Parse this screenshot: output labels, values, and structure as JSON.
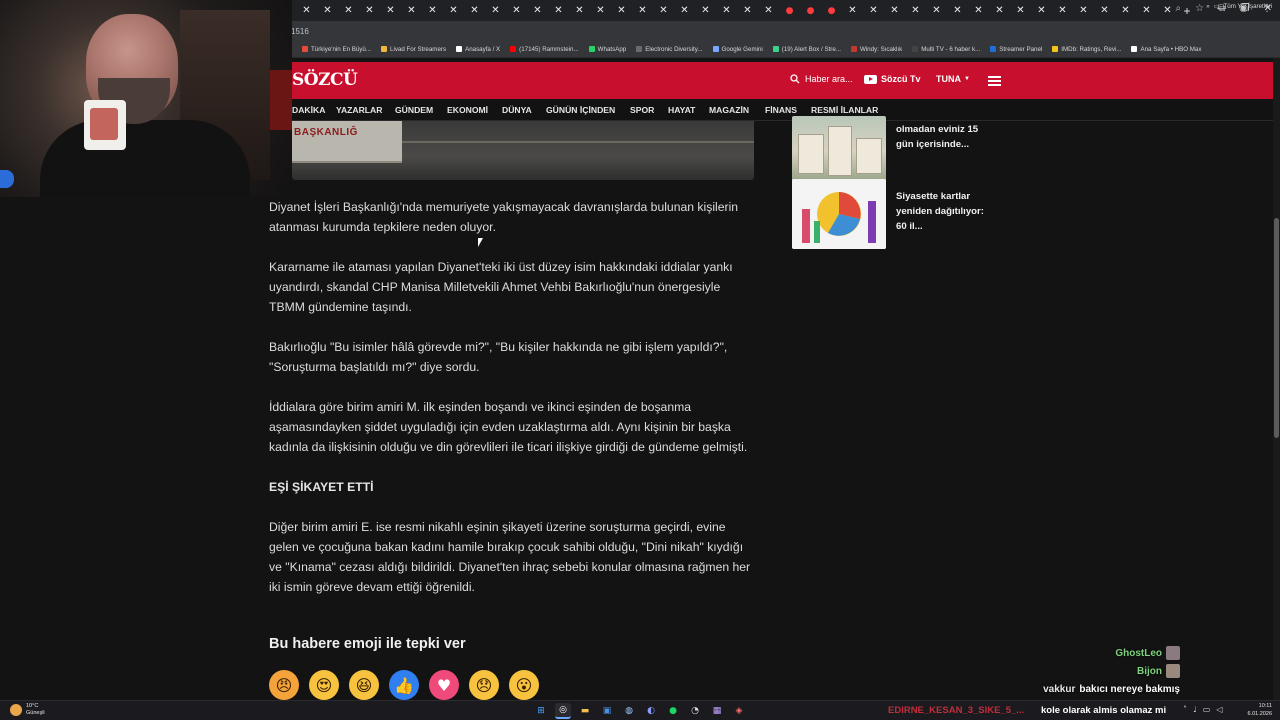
{
  "browser": {
    "tabs_visible": 42,
    "url_fragment": "1516",
    "bookmarks": [
      {
        "label": "Türkiye'nin En Büyü...",
        "color": "#e84a3a"
      },
      {
        "label": "Livad For Streamers",
        "color": "#f0b640"
      },
      {
        "label": "Anasayfa / X",
        "color": "#ffffff"
      },
      {
        "label": "(17145) Rammstein...",
        "color": "#ff0000"
      },
      {
        "label": "WhatsApp",
        "color": "#25d366"
      },
      {
        "label": "Electronic Diversity...",
        "color": "#6a6a6a"
      },
      {
        "label": "Google Gemini",
        "color": "#7aa7ff"
      },
      {
        "label": "(19) Alert Box / Stre...",
        "color": "#3bd38b"
      },
      {
        "label": "Windy: Sıcaklık",
        "color": "#c0392b"
      },
      {
        "label": "Multi TV - 6 haber k...",
        "color": "#444444"
      },
      {
        "label": "Streamer Panel",
        "color": "#1e6fd9"
      },
      {
        "label": "IMDb: Ratings, Revi...",
        "color": "#f5c518"
      },
      {
        "label": "Ana Sayfa • HBO Max",
        "color": "#ffffff"
      }
    ],
    "bookmarks_more": "»",
    "all_bookmarks": "Tüm Yer İşaretleri"
  },
  "site": {
    "logo": "SÖZCÜ",
    "search_placeholder": "Haber ara...",
    "tv_label": "Sözcü Tv",
    "user": "TUNA",
    "nav": [
      "DAKİKA",
      "YAZARLAR",
      "GÜNDEM",
      "EKONOMİ",
      "DÜNYA",
      "GÜNÜN İÇİNDEN",
      "SPOR",
      "HAYAT",
      "MAGAZİN",
      "FİNANS",
      "RESMİ İLANLAR"
    ],
    "accent": "#c8102e"
  },
  "hero": {
    "sign_text": "BAŞKANLIĞ"
  },
  "article": {
    "p1": "Diyanet İşleri Başkanlığı'nda memuriyete yakışmayacak davranışlarda bulunan kişilerin atanması kurumda tepkilere neden oluyor.",
    "p2": "Kararname ile ataması yapılan Diyanet'teki iki üst düzey isim hakkındaki iddialar yankı uyandırdı, skandal CHP Manisa Milletvekili Ahmet Vehbi Bakırlıoğlu'nun önergesiyle TBMM gündemine taşındı.",
    "p3": "Bakırlıoğlu \"Bu isimler hâlâ görevde mi?\", \"Bu kişiler hakkında ne gibi işlem yapıldı?\", \"Soruşturma başlatıldı mı?\" diye sordu.",
    "p4": "İddialara göre birim amiri M. ilk eşinden boşandı ve ikinci eşinden de boşanma aşamasındayken şiddet uyguladığı için evden uzaklaştırma aldı. Aynı kişinin bir başka kadınla da ilişkisinin olduğu ve din görevlileri ile ticari ilişkiye girdiği de gündeme gelmişti.",
    "heading": "EŞİ ŞİKAYET ETTİ",
    "p5": "Diğer birim amiri E. ise resmi nikahlı eşinin şikayeti üzerine soruşturma geçirdi, evine gelen ve çocuğuna bakan kadını hamile bırakıp çocuk sahibi olduğu, \"Dini nikah\" kıydığı ve \"Kınama\" cezası aldığı bildirildi. Diyanet'ten ihraç sebebi konular olmasına rağmen her iki ismin göreve devam ettiği öğrenildi."
  },
  "reactions": {
    "title": "Bu habere emoji ile tepki ver",
    "items": [
      {
        "icon": "angry-face",
        "glyph": "😠",
        "color": "#f4a23a"
      },
      {
        "icon": "heart-eyes-face",
        "glyph": "😍",
        "color": "#f7c23e"
      },
      {
        "icon": "laughing-face",
        "glyph": "😆",
        "color": "#f7c23e"
      },
      {
        "icon": "thumbs-up",
        "glyph": "👍",
        "color": "#2f7ff0"
      },
      {
        "icon": "heart",
        "glyph": "♥",
        "color": "#f04a7a"
      },
      {
        "icon": "sad-face",
        "glyph": "😞",
        "color": "#f7c23e"
      },
      {
        "icon": "surprised-face",
        "glyph": "😮",
        "color": "#f7c23e"
      }
    ]
  },
  "sidebar": {
    "cards": [
      {
        "title": "olmadan eviniz 15 gün içerisinde..."
      },
      {
        "title": "Siyasette kartlar yeniden dağıtılıyor: 60 il..."
      }
    ]
  },
  "chat": [
    {
      "name": "GhostLeo",
      "message": ""
    },
    {
      "name": "Bijon",
      "message": ""
    },
    {
      "name": "vakkur",
      "message": "bakıcı nereye bakmış"
    },
    {
      "name": "",
      "message": "kole olarak almis olamaz mi"
    }
  ],
  "taskbar": {
    "weather_temp": "10°C",
    "weather_desc": "Güneşli",
    "ticker": "EDIRNE_KESAN_3_SIKE_5_...",
    "time": "10:11",
    "date": "6.01.2026"
  }
}
